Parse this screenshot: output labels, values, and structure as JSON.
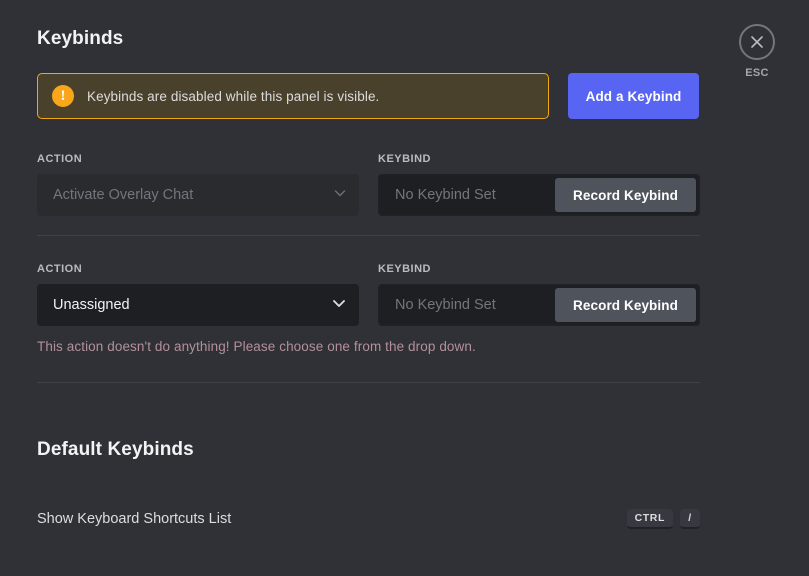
{
  "header": {
    "title": "Keybinds",
    "close_icon": "close-x-icon",
    "esc_label": "ESC"
  },
  "warning": {
    "icon": "exclamation-icon",
    "icon_glyph": "!",
    "text": "Keybinds are disabled while this panel is visible.",
    "border_color": "#f0a80e",
    "background_color": "#4a412d"
  },
  "add_keybind": {
    "label": "Add a Keybind",
    "color": "#5865f2"
  },
  "columns": {
    "action": "ACTION",
    "keybind": "KEYBIND"
  },
  "keybind_rows": [
    {
      "action_value": "Activate Overlay Chat",
      "action_disabled": true,
      "keybind_placeholder": "No Keybind Set",
      "record_label": "Record Keybind",
      "error": null
    },
    {
      "action_value": "Unassigned",
      "action_disabled": false,
      "keybind_placeholder": "No Keybind Set",
      "record_label": "Record Keybind",
      "error": "This action doesn't do anything! Please choose one from the drop down."
    }
  ],
  "defaults": {
    "title": "Default Keybinds",
    "rows": [
      {
        "label": "Show Keyboard Shortcuts List",
        "keys": [
          "CTRL",
          "/"
        ]
      }
    ]
  }
}
